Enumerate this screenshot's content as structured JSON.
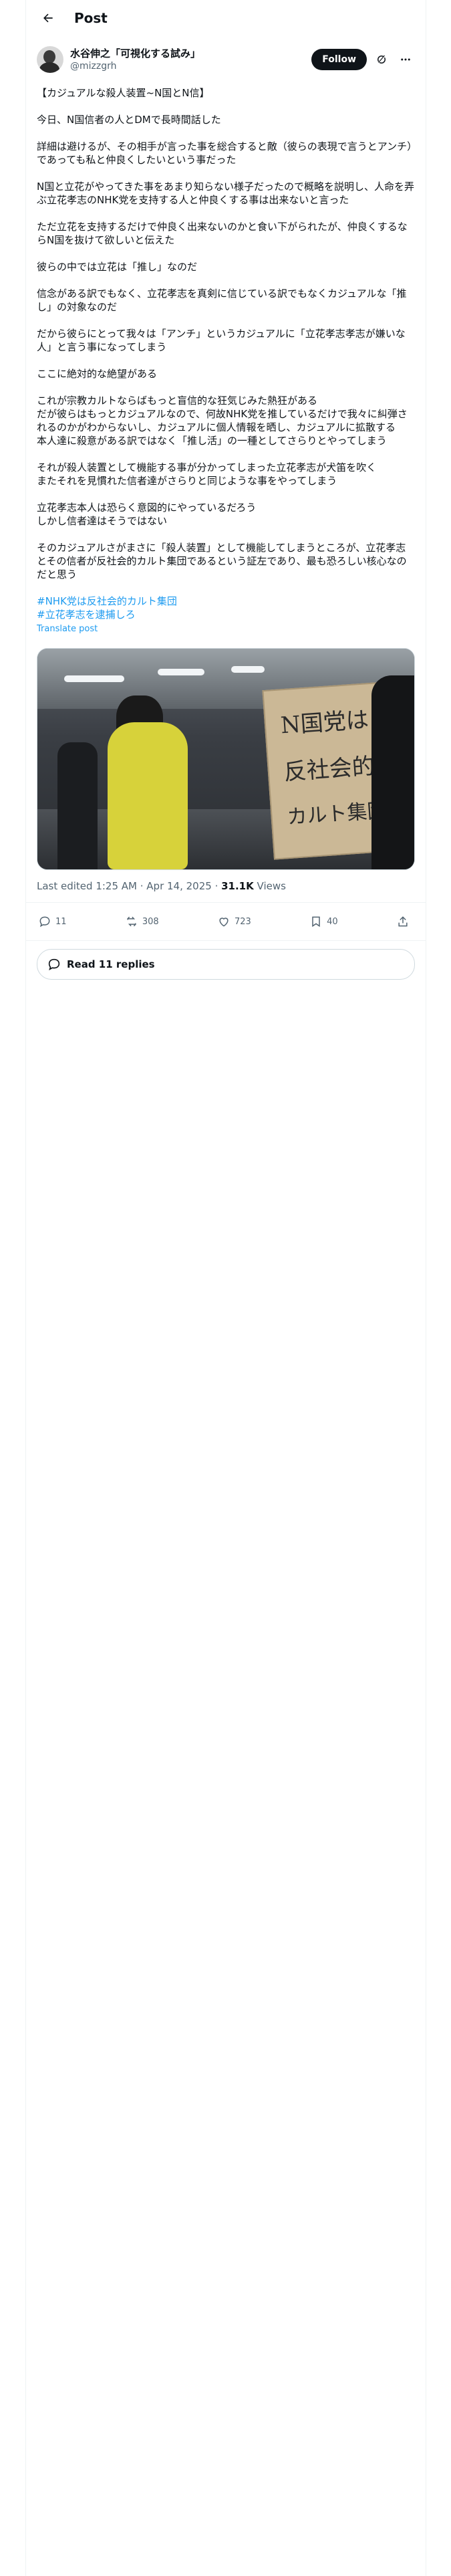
{
  "header": {
    "title": "Post"
  },
  "author": {
    "display_name": "水谷伸之「可視化する試み」",
    "handle": "@mizzgrh",
    "follow_label": "Follow"
  },
  "post": {
    "text": "【カジュアルな殺人装置~N国とN信】\n\n今日、N国信者の人とDMで長時間話した\n\n詳細は避けるが、その相手が言った事を総合すると敵（彼らの表現で言うとアンチ）であっても私と仲良くしたいという事だった\n\nN国と立花がやってきた事をあまり知らない様子だったので概略を説明し、人命を弄ぶ立花孝志のNHK党を支持する人と仲良くする事は出来ないと言った\n\nただ立花を支持するだけで仲良く出来ないのかと食い下がられたが、仲良くするならN国を抜けて欲しいと伝えた\n\n彼らの中では立花は「推し」なのだ\n\n信念がある訳でもなく、立花孝志を真剣に信じている訳でもなくカジュアルな「推し」の対象なのだ\n\nだから彼らにとって我々は「アンチ」というカジュアルに「立花孝志孝志が嫌いな人」と言う事になってしまう\n\nここに絶対的な絶望がある\n\nこれが宗教カルトならばもっと盲信的な狂気じみた熱狂がある\nだが彼らはもっとカジュアルなので、何故NHK党を推しているだけで我々に糾弾されるのかがわからないし、カジュアルに個人情報を晒し、カジュアルに拡散する\n本人達に殺意がある訳ではなく「推し活」の一種としてさらりとやってしまう\n\nそれが殺人装置として機能する事が分かってしまった立花孝志が犬笛を吹く\nまたそれを見慣れた信者達がさらりと同じような事をやってしまう\n\n立花孝志本人は恐らく意図的にやっているだろう\nしかし信者達はそうではない\n\nそのカジュアルさがまさに「殺人装置」として機能してしまうところが、立花孝志とその信者が反社会的カルト集団であるという証左であり、最も恐ろしい核心なのだと思う",
    "hashtags": [
      "#NHK党は反社会的カルト集団",
      "#立花孝志を逮捕しろ"
    ],
    "translate_label": "Translate post",
    "image_sign_text": [
      "N国党は",
      "反社会的",
      "カルト集団"
    ],
    "edited_label": "Last edited 1:25 AM · Apr 14, 2025 · ",
    "views_count": "31.1K",
    "views_label": " Views"
  },
  "actions": {
    "replies": "11",
    "reposts": "308",
    "likes": "723",
    "bookmarks": "40"
  },
  "read_replies_label": "Read 11 replies"
}
